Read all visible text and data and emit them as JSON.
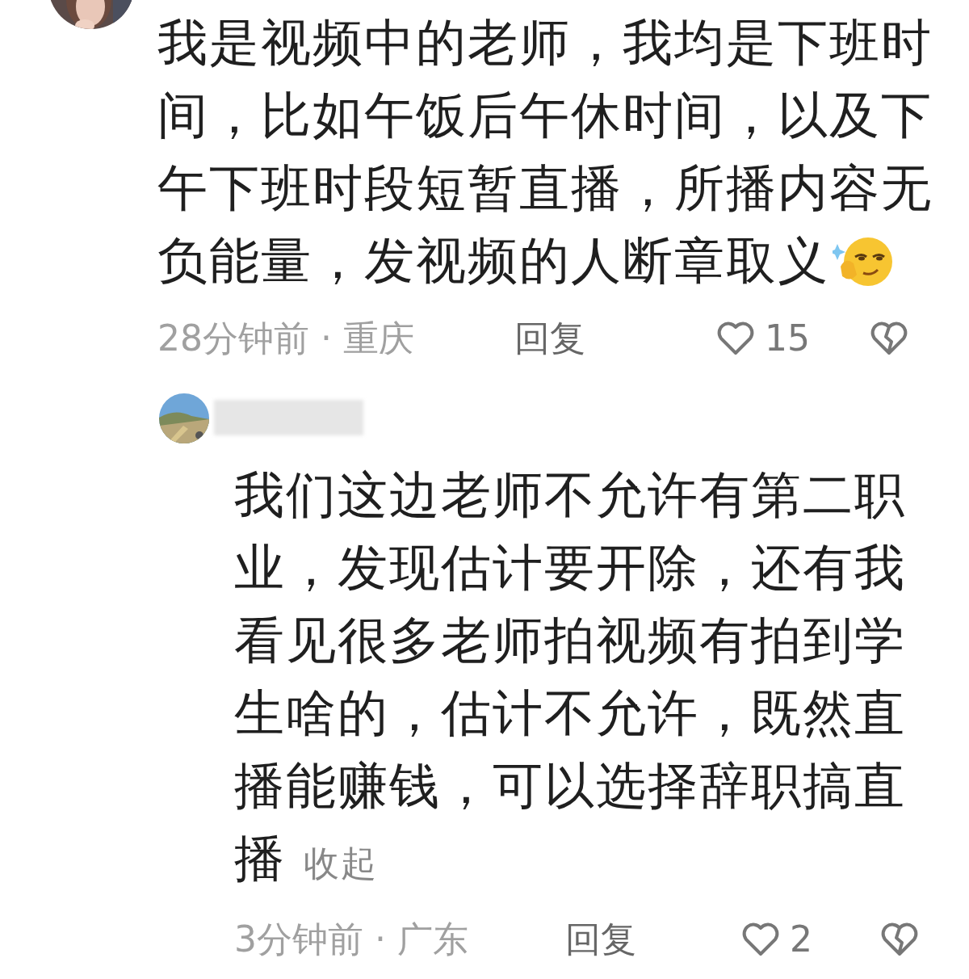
{
  "comment": {
    "text": "我是视频中的老师，我均是下班时间，比如午饭后午休时间，以及下午下班时段短暂直播，所播内容无负能量，发视频的人断章取义",
    "time_location": "28分钟前 · 重庆",
    "reply_label": "回复",
    "likes": "15"
  },
  "reply": {
    "text": "我们这边老师不允许有第二职业，发现估计要开除，还有我看见很多老师拍视频有拍到学生啥的，估计不允许，既然直播能赚钱，可以选择辞职搞直播",
    "collapse": "收起",
    "time_location": "3分钟前 · 广东",
    "reply_label": "回复",
    "likes": "2"
  }
}
